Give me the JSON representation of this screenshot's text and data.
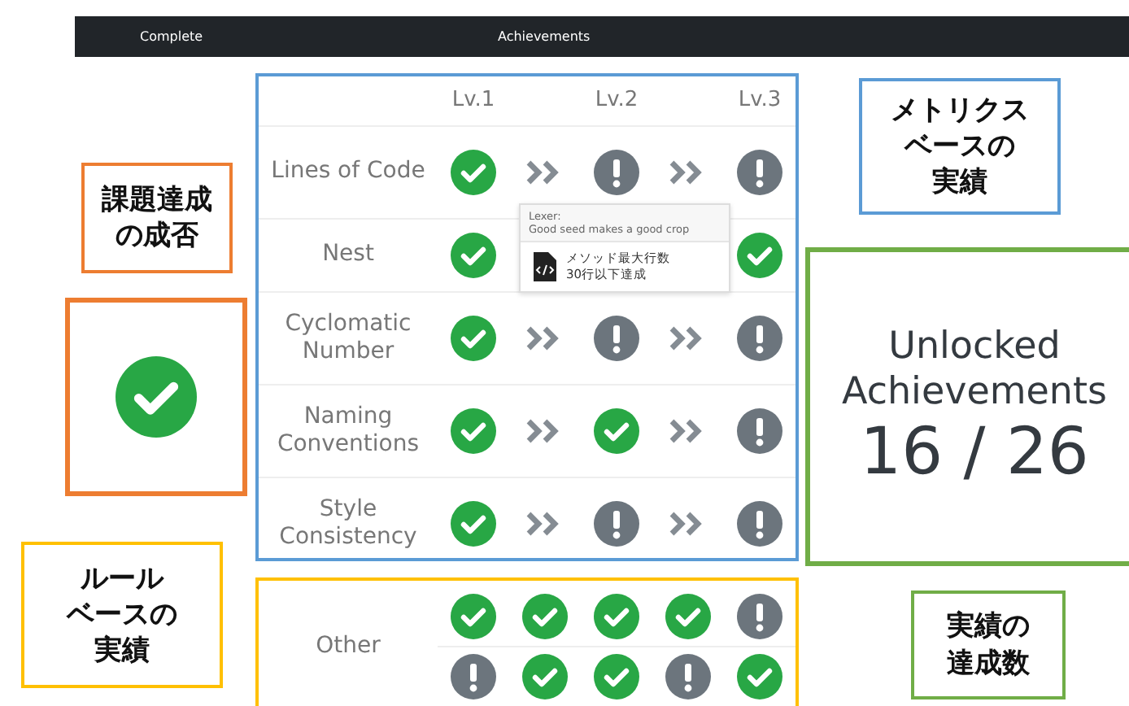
{
  "header": {
    "tabs": [
      "Complete",
      "Achievements"
    ]
  },
  "task_status": {
    "passed": true
  },
  "metrics": {
    "levels": [
      "Lv.1",
      "Lv.2",
      "Lv.3"
    ],
    "rows": [
      {
        "name": "Lines of Code",
        "levels": [
          true,
          false,
          false
        ]
      },
      {
        "name": "Nest",
        "levels": [
          true,
          true
        ],
        "tooltip": {
          "title": "Lexer:",
          "subtitle": "Good seed makes a good crop",
          "lines": [
            "メソッド最大行数",
            "30行以下達成"
          ]
        }
      },
      {
        "name": "Cyclomatic Number",
        "levels": [
          true,
          false,
          false
        ]
      },
      {
        "name": "Naming Conventions",
        "levels": [
          true,
          true,
          false
        ]
      },
      {
        "name": "Style Consistency",
        "levels": [
          true,
          false,
          false
        ]
      }
    ]
  },
  "other": {
    "name": "Other",
    "rows": [
      [
        true,
        true,
        true,
        true,
        false
      ],
      [
        false,
        true,
        true,
        false,
        true
      ]
    ]
  },
  "summary": {
    "label": "Unlocked Achievements",
    "count": "16 / 26"
  },
  "callouts": [
    {
      "kind": "status",
      "lines": [
        "課題達成",
        "の成否"
      ],
      "color": "#ed7d31"
    },
    {
      "kind": "metrics",
      "lines": [
        "メトリクス",
        "ベースの",
        "実績"
      ],
      "color": "#5b9bd5"
    },
    {
      "kind": "rules",
      "lines": [
        "ルール",
        "ベースの",
        "実績"
      ],
      "color": "#ffc000"
    },
    {
      "kind": "count",
      "lines": [
        "実績の",
        "達成数"
      ],
      "color": "#70ad47"
    }
  ]
}
